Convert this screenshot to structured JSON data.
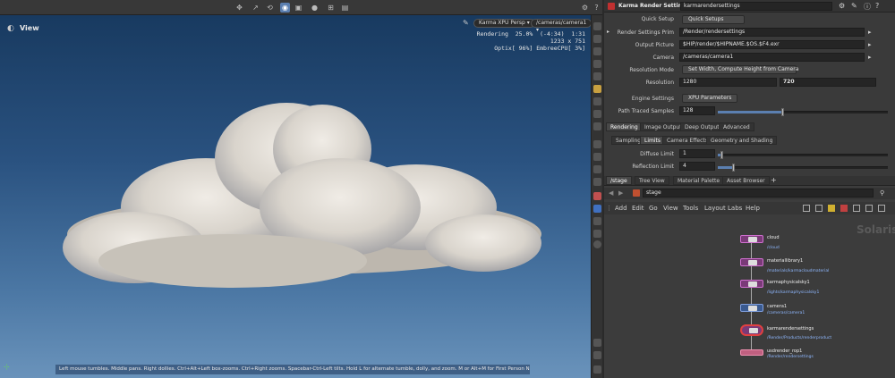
{
  "viewport": {
    "title": "View",
    "renderer": "Karma XPU  Persp ▾",
    "camera": "/cameras/camera1 ▾",
    "stats": [
      "Rendering  25.0%  (-4:34)  1:31",
      "1233 x 751",
      "Optix[ 96%] EmbreeCPU[ 3%]"
    ],
    "status_text": "Left mouse tumbles. Middle pans. Right dollies. Ctrl+Alt+Left box-zooms. Ctrl+Right zooms. Spacebar-Ctrl-Left tilts. Hold L for alternate tumble, dolly, and zoom. M or Alt+M for First Person Navigation."
  },
  "params": {
    "node_type": "Karma Render Settings",
    "node_name": "karmarendersettings",
    "quick_setup_label": "Quick Setup",
    "quick_setup_value": "Quick Setups",
    "render_settings_prim_label": "Render Settings Prim",
    "render_settings_prim": "/Render/rendersettings",
    "output_picture_label": "Output Picture",
    "output_picture": "$HIP/render/$HIPNAME.$OS.$F4.exr",
    "camera_label": "Camera",
    "camera": "/cameras/camera1",
    "resolution_mode_label": "Resolution Mode",
    "resolution_mode": "Set Width, Compute Height from Camera",
    "resolution_label": "Resolution",
    "res_x": "1280",
    "res_y": "720",
    "engine_settings_label": "Engine Settings",
    "engine": "XPU Parameters",
    "path_traced_samples_label": "Path Traced Samples",
    "path_traced_samples": "128",
    "path_traced_fraction": 0.38,
    "main_tabs": [
      "Rendering",
      "Image Output",
      "Deep Output",
      "Advanced"
    ],
    "sub_tabs": [
      "Sampling",
      "Limits",
      "Camera Effects",
      "Geometry and Shading"
    ],
    "diffuse_limit_label": "Diffuse Limit",
    "diffuse_limit": "1",
    "diffuse_fraction": 0.02,
    "reflection_limit_label": "Reflection Limit",
    "reflection_limit": "4",
    "reflection_fraction": 0.09
  },
  "network": {
    "pane_tabs": [
      "/stage",
      "Tree View",
      "Material Palette",
      "Asset Browser"
    ],
    "path": "stage",
    "menu": [
      "Add",
      "Edit",
      "Go",
      "View",
      "Tools",
      "Layout",
      "Labs",
      "Help"
    ],
    "context_label": "Solaris",
    "nodes": [
      {
        "name": "cloud",
        "path": "/cloud"
      },
      {
        "name": "materiallibrary1",
        "path": "/materials/karmacloudmaterial"
      },
      {
        "name": "karmaphysicalsky1",
        "path": "/lights/karmaphysicalsky1"
      },
      {
        "name": "camera1",
        "path": "/cameras/camera1"
      },
      {
        "name": "karmarendersettings",
        "path": "/Render/Products/renderproduct"
      },
      {
        "name": "usdrender_rop1",
        "path": "/Render/rendersettings"
      }
    ]
  },
  "colors": {
    "accent": "#5b7fb0",
    "node_pink": "#d070d0",
    "node_selected": "#e04040"
  }
}
